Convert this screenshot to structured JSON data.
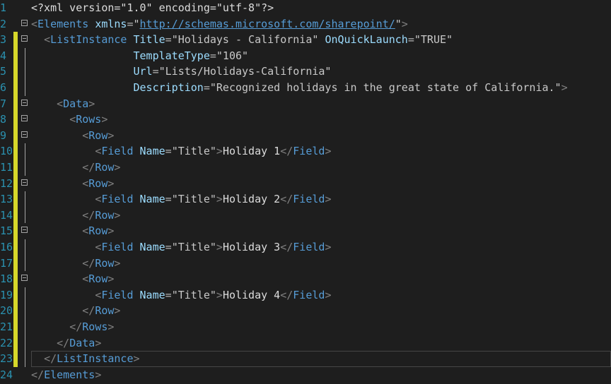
{
  "editor": {
    "line_numbers": [
      "1",
      "2",
      "3",
      "4",
      "5",
      "6",
      "7",
      "8",
      "9",
      "10",
      "11",
      "12",
      "13",
      "14",
      "15",
      "16",
      "17",
      "18",
      "19",
      "20",
      "21",
      "22",
      "23",
      "24"
    ],
    "lines": [
      [
        [
          "pi",
          "<?xml version=\"1.0\" encoding=\"utf-8\"?>"
        ]
      ],
      [
        [
          "br",
          "<"
        ],
        [
          "tag",
          "Elements"
        ],
        [
          "sp",
          " "
        ],
        [
          "attr",
          "xmlns"
        ],
        [
          "eq",
          "="
        ],
        [
          "q",
          "\""
        ],
        [
          "url",
          "http://schemas.microsoft.com/sharepoint/"
        ],
        [
          "q",
          "\""
        ],
        [
          "br",
          ">"
        ]
      ],
      [
        [
          "sp",
          "  "
        ],
        [
          "br",
          "<"
        ],
        [
          "tag",
          "ListInstance"
        ],
        [
          "sp",
          " "
        ],
        [
          "attr",
          "Title"
        ],
        [
          "eq",
          "="
        ],
        [
          "val",
          "\"Holidays - California\""
        ],
        [
          "sp",
          " "
        ],
        [
          "attr",
          "OnQuickLaunch"
        ],
        [
          "eq",
          "="
        ],
        [
          "val",
          "\"TRUE\""
        ]
      ],
      [
        [
          "sp",
          "                "
        ],
        [
          "attr",
          "TemplateType"
        ],
        [
          "eq",
          "="
        ],
        [
          "val",
          "\"106\""
        ]
      ],
      [
        [
          "sp",
          "                "
        ],
        [
          "attr",
          "Url"
        ],
        [
          "eq",
          "="
        ],
        [
          "val",
          "\"Lists/Holidays-California\""
        ]
      ],
      [
        [
          "sp",
          "                "
        ],
        [
          "attr",
          "Description"
        ],
        [
          "eq",
          "="
        ],
        [
          "val",
          "\"Recognized holidays in the great state of California.\""
        ],
        [
          "br",
          ">"
        ]
      ],
      [
        [
          "sp",
          "    "
        ],
        [
          "br",
          "<"
        ],
        [
          "tag",
          "Data"
        ],
        [
          "br",
          ">"
        ]
      ],
      [
        [
          "sp",
          "      "
        ],
        [
          "br",
          "<"
        ],
        [
          "tag",
          "Rows"
        ],
        [
          "br",
          ">"
        ]
      ],
      [
        [
          "sp",
          "        "
        ],
        [
          "br",
          "<"
        ],
        [
          "tag",
          "Row"
        ],
        [
          "br",
          ">"
        ]
      ],
      [
        [
          "sp",
          "          "
        ],
        [
          "br",
          "<"
        ],
        [
          "tag",
          "Field"
        ],
        [
          "sp",
          " "
        ],
        [
          "attr",
          "Name"
        ],
        [
          "eq",
          "="
        ],
        [
          "val",
          "\"Title\""
        ],
        [
          "br",
          ">"
        ],
        [
          "txt",
          "Holiday 1"
        ],
        [
          "br",
          "</"
        ],
        [
          "tag",
          "Field"
        ],
        [
          "br",
          ">"
        ]
      ],
      [
        [
          "sp",
          "        "
        ],
        [
          "br",
          "</"
        ],
        [
          "tag",
          "Row"
        ],
        [
          "br",
          ">"
        ]
      ],
      [
        [
          "sp",
          "        "
        ],
        [
          "br",
          "<"
        ],
        [
          "tag",
          "Row"
        ],
        [
          "br",
          ">"
        ]
      ],
      [
        [
          "sp",
          "          "
        ],
        [
          "br",
          "<"
        ],
        [
          "tag",
          "Field"
        ],
        [
          "sp",
          " "
        ],
        [
          "attr",
          "Name"
        ],
        [
          "eq",
          "="
        ],
        [
          "val",
          "\"Title\""
        ],
        [
          "br",
          ">"
        ],
        [
          "txt",
          "Holiday 2"
        ],
        [
          "br",
          "</"
        ],
        [
          "tag",
          "Field"
        ],
        [
          "br",
          ">"
        ]
      ],
      [
        [
          "sp",
          "        "
        ],
        [
          "br",
          "</"
        ],
        [
          "tag",
          "Row"
        ],
        [
          "br",
          ">"
        ]
      ],
      [
        [
          "sp",
          "        "
        ],
        [
          "br",
          "<"
        ],
        [
          "tag",
          "Row"
        ],
        [
          "br",
          ">"
        ]
      ],
      [
        [
          "sp",
          "          "
        ],
        [
          "br",
          "<"
        ],
        [
          "tag",
          "Field"
        ],
        [
          "sp",
          " "
        ],
        [
          "attr",
          "Name"
        ],
        [
          "eq",
          "="
        ],
        [
          "val",
          "\"Title\""
        ],
        [
          "br",
          ">"
        ],
        [
          "txt",
          "Holiday 3"
        ],
        [
          "br",
          "</"
        ],
        [
          "tag",
          "Field"
        ],
        [
          "br",
          ">"
        ]
      ],
      [
        [
          "sp",
          "        "
        ],
        [
          "br",
          "</"
        ],
        [
          "tag",
          "Row"
        ],
        [
          "br",
          ">"
        ]
      ],
      [
        [
          "sp",
          "        "
        ],
        [
          "br",
          "<"
        ],
        [
          "tag",
          "Row"
        ],
        [
          "br",
          ">"
        ]
      ],
      [
        [
          "sp",
          "          "
        ],
        [
          "br",
          "<"
        ],
        [
          "tag",
          "Field"
        ],
        [
          "sp",
          " "
        ],
        [
          "attr",
          "Name"
        ],
        [
          "eq",
          "="
        ],
        [
          "val",
          "\"Title\""
        ],
        [
          "br",
          ">"
        ],
        [
          "txt",
          "Holiday 4"
        ],
        [
          "br",
          "</"
        ],
        [
          "tag",
          "Field"
        ],
        [
          "br",
          ">"
        ]
      ],
      [
        [
          "sp",
          "        "
        ],
        [
          "br",
          "</"
        ],
        [
          "tag",
          "Row"
        ],
        [
          "br",
          ">"
        ]
      ],
      [
        [
          "sp",
          "      "
        ],
        [
          "br",
          "</"
        ],
        [
          "tag",
          "Rows"
        ],
        [
          "br",
          ">"
        ]
      ],
      [
        [
          "sp",
          "    "
        ],
        [
          "br",
          "</"
        ],
        [
          "tag",
          "Data"
        ],
        [
          "br",
          ">"
        ]
      ],
      [
        [
          "sp",
          "  "
        ],
        [
          "br",
          "</"
        ],
        [
          "tag",
          "ListInstance"
        ],
        [
          "br",
          ">"
        ]
      ],
      [
        [
          "br",
          "</"
        ],
        [
          "tag",
          "Elements"
        ],
        [
          "br",
          ">"
        ]
      ]
    ],
    "foldable_lines": [
      2,
      3,
      7,
      8,
      9,
      12,
      15,
      18
    ],
    "changed_lines": [
      3,
      4,
      5,
      6,
      7,
      8,
      9,
      10,
      11,
      12,
      13,
      14,
      15,
      16,
      17,
      18,
      19,
      20,
      21,
      22,
      23
    ],
    "current_line": 23,
    "colors": {
      "background": "#1e1e1e",
      "line_number": "#2b91af",
      "change_marker": "#d6d72a",
      "tag": "#569cd6",
      "attribute": "#9cdcfe",
      "value": "#c8c8c8",
      "text": "#dcdcdc",
      "bracket": "#808080"
    }
  }
}
